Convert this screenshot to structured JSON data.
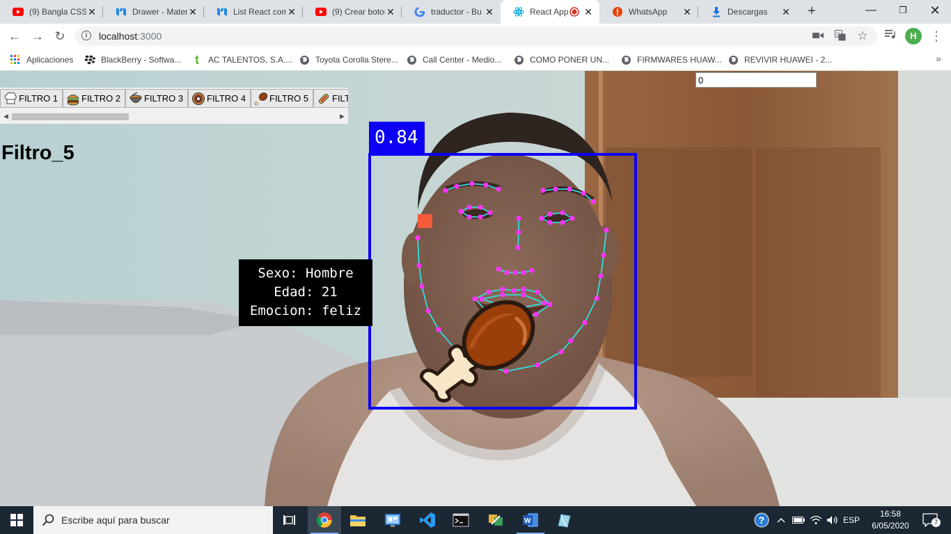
{
  "browser": {
    "tabs": [
      {
        "title": "(9) Bangla CSS",
        "icon": "youtube-icon",
        "active": false
      },
      {
        "title": "Drawer - Mater",
        "icon": "material-ui-icon",
        "active": false
      },
      {
        "title": "List React com",
        "icon": "material-ui-icon",
        "active": false
      },
      {
        "title": "(9) Crear botor",
        "icon": "youtube-icon",
        "active": false
      },
      {
        "title": "traductor - Bu",
        "icon": "google-icon",
        "active": false
      },
      {
        "title": "React App",
        "icon": "react-icon",
        "active": true
      },
      {
        "title": "WhatsApp",
        "icon": "whatsapp-icon",
        "active": false
      },
      {
        "title": "Descargas",
        "icon": "download-icon",
        "active": false
      }
    ],
    "url_host": "localhost",
    "url_port": ":3000",
    "profile_initial": "H",
    "bookmarks": [
      {
        "label": "Aplicaciones",
        "icon": "apps-grid-icon"
      },
      {
        "label": "BlackBerry - Softwa...",
        "icon": "blackberry-icon"
      },
      {
        "label": "AC TALENTOS, S.A....",
        "icon": "t-logo-icon"
      },
      {
        "label": "Toyota Corolla Stere...",
        "icon": "globe-icon"
      },
      {
        "label": "Call Center - Medio...",
        "icon": "globe-icon"
      },
      {
        "label": "COMO PONER UN...",
        "icon": "globe-icon"
      },
      {
        "label": "FIRMWARES HUAW...",
        "icon": "globe-icon"
      },
      {
        "label": "REVIVIR HUAWEI - 2...",
        "icon": "globe-icon"
      }
    ]
  },
  "app": {
    "filters": [
      {
        "label": "FILTRO 1",
        "icon": "chef-hat-icon"
      },
      {
        "label": "FILTRO 2",
        "icon": "burger-icon"
      },
      {
        "label": "FILTRO 3",
        "icon": "bowl-icon"
      },
      {
        "label": "FILTRO 4",
        "icon": "donut-icon"
      },
      {
        "label": "FILTRO 5",
        "icon": "drumstick-icon"
      },
      {
        "label": "FILT",
        "icon": "hotdog-icon"
      }
    ],
    "selected_filter_title": "Filtro_5",
    "counter_value": "0",
    "detection_score": "0.84",
    "info_lines": [
      "Sexo: Hombre",
      "Edad: 21",
      "Emocion: feliz"
    ]
  },
  "taskbar": {
    "search_placeholder": "Escribe aquí para buscar",
    "language": "ESP",
    "time": "16:58",
    "date": "6/05/2020",
    "notification_count": "7"
  },
  "colors": {
    "face_box": "#0d00f5",
    "landmark_points": "#ff33ff",
    "landmark_lines": "#33dddd",
    "marker_square": "#f55a3a",
    "drumstick": "#9a3f0a"
  }
}
